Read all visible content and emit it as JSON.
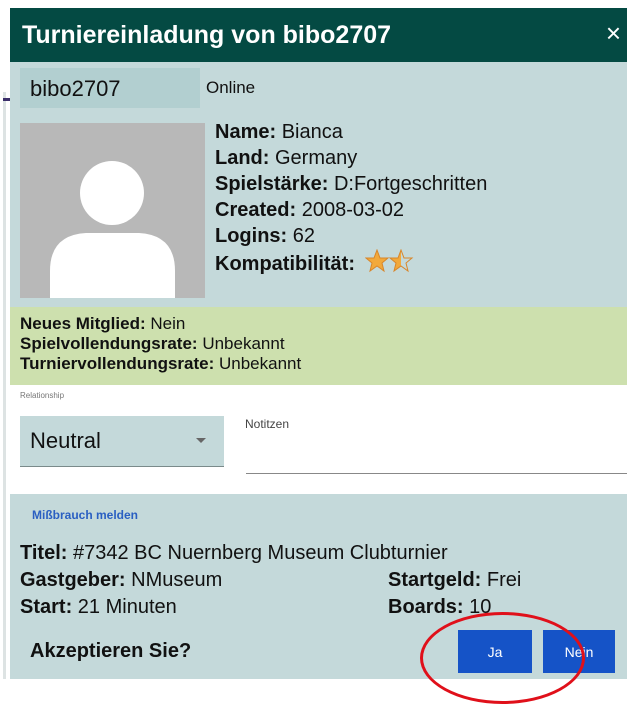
{
  "dialog": {
    "title": "Turniereinladung von bibo2707",
    "close_symbol": "×"
  },
  "user": {
    "username": "bibo2707",
    "status": "Online"
  },
  "profile": {
    "name_label": "Name:",
    "name": "Bianca",
    "country_label": "Land:",
    "country": "Germany",
    "skill_label": "Spielstärke:",
    "skill": "D:Fortgeschritten",
    "created_label": "Created:",
    "created": "2008-03-02",
    "logins_label": "Logins:",
    "logins": "62",
    "compat_label": "Kompatibilität:",
    "compat_stars": 1.5,
    "compat_stars_max": 2
  },
  "membership": {
    "new_member_label": "Neues Mitglied:",
    "new_member": "Nein",
    "game_rate_label": "Spielvollendungsrate:",
    "game_rate": "Unbekannt",
    "tourney_rate_label": "Turniervollendungsrate:",
    "tourney_rate": "Unbekannt"
  },
  "relationship": {
    "label": "Relationship",
    "value": "Neutral",
    "notes_label": "Notitzen",
    "notes_value": ""
  },
  "abuse_link": "Mißbrauch melden",
  "tournament": {
    "title_label": "Titel:",
    "title": "#7342 BC Nuernberg Museum Clubturnier",
    "host_label": "Gastgeber:",
    "host": "NMuseum",
    "fee_label": "Startgeld:",
    "fee": "Frei",
    "start_label": "Start:",
    "start": "21 Minuten",
    "boards_label": "Boards:",
    "boards": "10"
  },
  "prompt": {
    "question": "Akzeptieren Sie?",
    "yes_label": "Ja",
    "no_label": "Nein"
  },
  "colors": {
    "titlebar": "#044a43",
    "panel": "#c4d9da",
    "highlight": "#cde0ae",
    "button": "#1553c7",
    "star": "#f2a93b",
    "annotation": "#e0101a"
  },
  "icons": {
    "avatar": "user-silhouette-icon",
    "close": "close-icon",
    "dropdown": "chevron-down-icon",
    "star": "star-icon"
  }
}
